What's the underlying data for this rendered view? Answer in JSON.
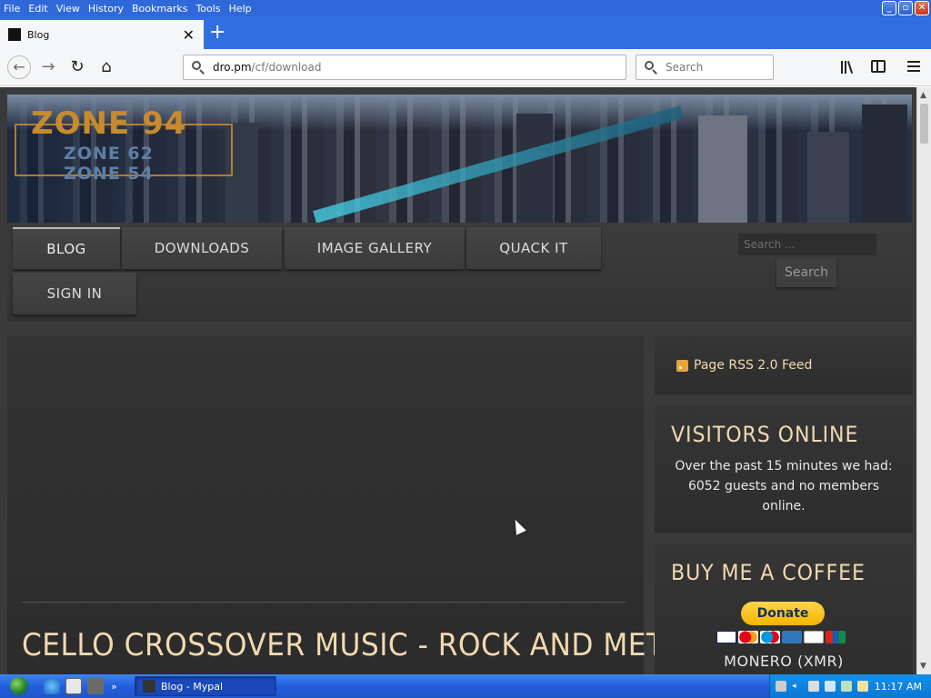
{
  "menubar": {
    "items": [
      "File",
      "Edit",
      "View",
      "History",
      "Bookmarks",
      "Tools",
      "Help"
    ]
  },
  "tab": {
    "title": "Blog"
  },
  "navbar": {
    "url_host": "dro.pm",
    "url_path": "/cf/download",
    "search_placeholder": "Search"
  },
  "site": {
    "logo_main": "ZONE 94",
    "logo_sub1": "ZONE 62",
    "logo_sub2": "ZONE 54",
    "nav": [
      "BLOG",
      "DOWNLOADS",
      "IMAGE GALLERY",
      "QUACK IT",
      "SIGN IN"
    ],
    "active_nav": "BLOG",
    "search_placeholder": "Search ...",
    "search_button": "Search"
  },
  "main": {
    "post_title": "CELLO CROSSOVER MUSIC - ROCK AND METAL"
  },
  "sidebar": {
    "rss_label": "Page RSS 2.0 Feed",
    "visitors_title": "VISITORS ONLINE",
    "visitors_text": "Over the past 15 minutes we had: 6052 guests and no members online.",
    "coffee_title": "BUY ME A COFFEE",
    "donate_label": "Donate",
    "monero_label": "MONERO (XMR)"
  },
  "taskbar": {
    "task_label": "Blog - Mypal",
    "clock": "11:17 AM"
  },
  "colors": {
    "accent_text": "#f2d9b0",
    "titlebar_blue": "#2f6fe0",
    "page_bg": "#3a3a3a"
  }
}
